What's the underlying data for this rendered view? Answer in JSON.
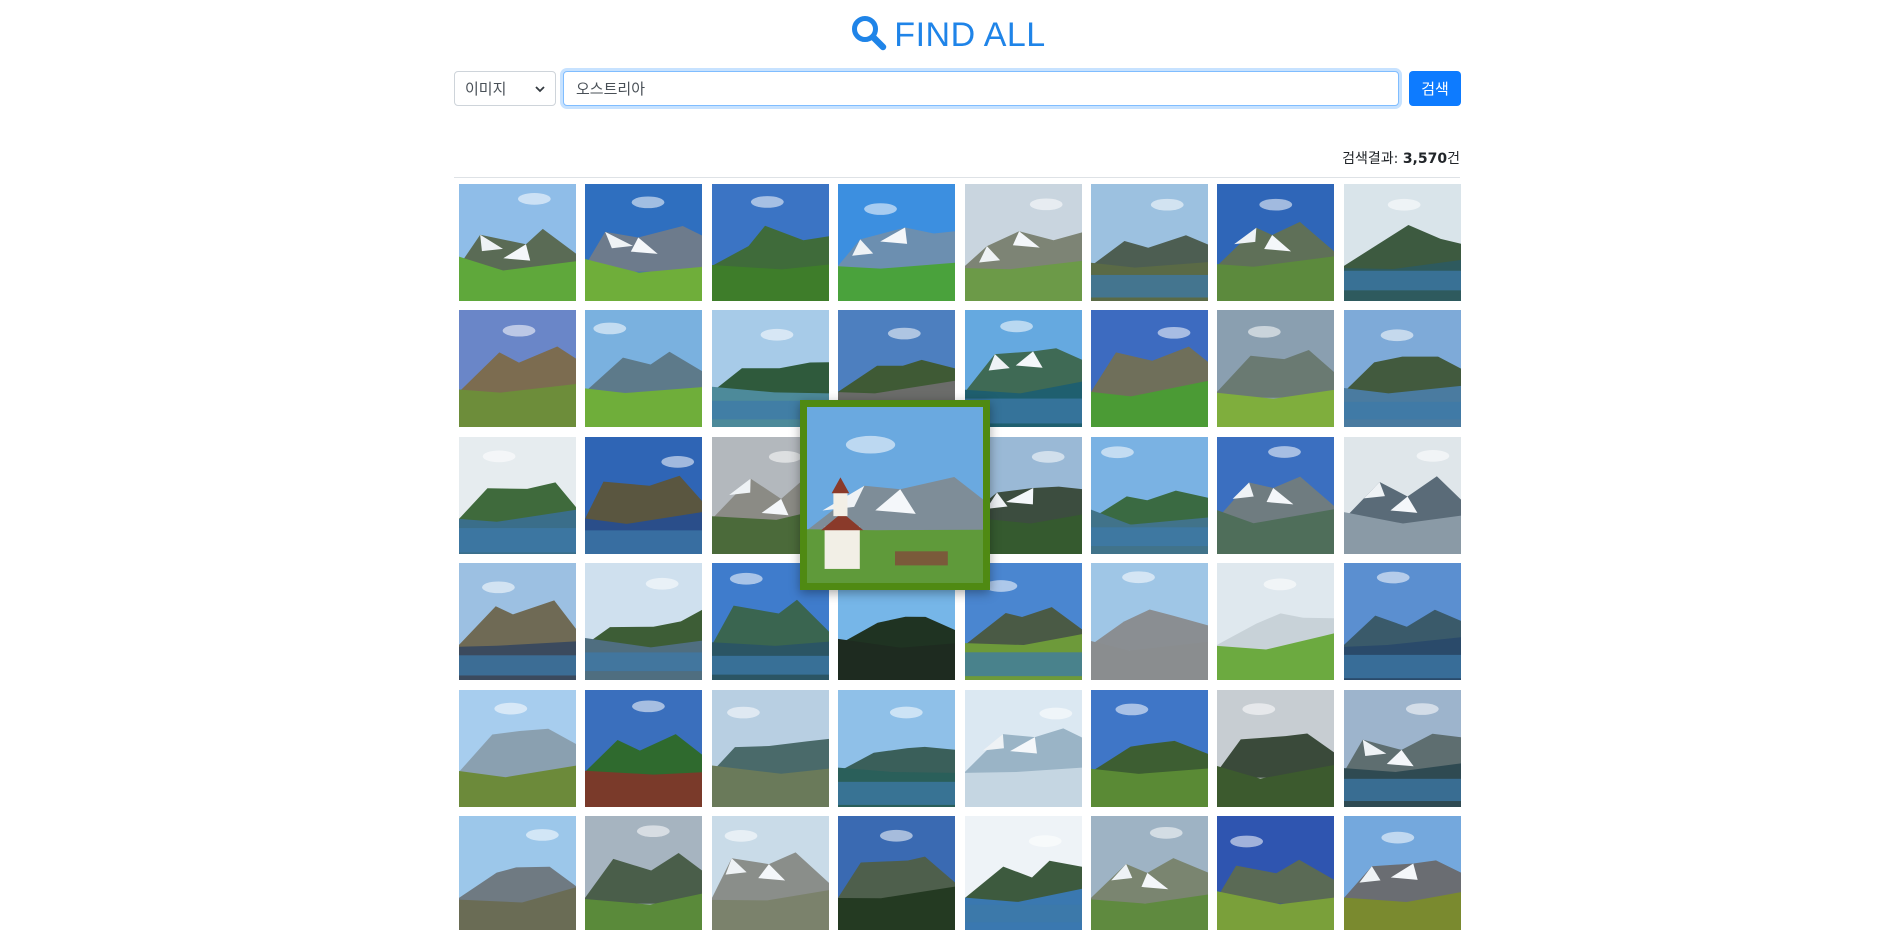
{
  "header": {
    "title": "FIND ALL",
    "icon": "search-icon",
    "color": "#1f84e8"
  },
  "search": {
    "type_selected": "이미지",
    "query": "오스트리아",
    "button_label": "검색",
    "button_color": "#0d7bff"
  },
  "results": {
    "summary_label": "검색결과:",
    "count": "3,570",
    "count_suffix": "건",
    "columns": 8,
    "rows": 6,
    "images": [
      {
        "sky": "#8fbde8",
        "mtn": "#5a6b55",
        "snow": true,
        "ground": "#5fa83b",
        "water": false
      },
      {
        "sky": "#2f6fbf",
        "mtn": "#6d7b8c",
        "snow": true,
        "ground": "#6fae3a",
        "water": false
      },
      {
        "sky": "#3b74c4",
        "mtn": "#3f6b3a",
        "snow": false,
        "ground": "#3e7d2a",
        "water": false
      },
      {
        "sky": "#3c8fe0",
        "mtn": "#6c8fb0",
        "snow": true,
        "ground": "#4aa23c",
        "water": false
      },
      {
        "sky": "#c9d5df",
        "mtn": "#7d8475",
        "snow": true,
        "ground": "#6c9a48",
        "water": false
      },
      {
        "sky": "#9cc1e0",
        "mtn": "#4d5e52",
        "snow": false,
        "ground": "#5a6a46",
        "water": true
      },
      {
        "sky": "#2f66b8",
        "mtn": "#5f7058",
        "snow": true,
        "ground": "#5c8a3d",
        "water": false
      },
      {
        "sky": "#d9e4ea",
        "mtn": "#3d5a40",
        "snow": false,
        "ground": "#2e5a5e",
        "water": true
      },
      {
        "sky": "#6a86c8",
        "mtn": "#7c6c50",
        "snow": false,
        "ground": "#6d8d3a",
        "water": false
      },
      {
        "sky": "#7ab1df",
        "mtn": "#5d7a8a",
        "snow": false,
        "ground": "#6fae3a",
        "water": false
      },
      {
        "sky": "#a7cbe8",
        "mtn": "#2f5a3c",
        "snow": false,
        "ground": "#4d8a9a",
        "water": true
      },
      {
        "sky": "#4d7fbf",
        "mtn": "#3f5a35",
        "snow": false,
        "ground": "#6b6c6a",
        "water": true
      },
      {
        "sky": "#65a9e0",
        "mtn": "#3f6a55",
        "snow": true,
        "ground": "#1f5f6f",
        "water": true
      },
      {
        "sky": "#3d6bc0",
        "mtn": "#6f6f5a",
        "snow": false,
        "ground": "#4b9b35",
        "water": false
      },
      {
        "sky": "#8a9fb0",
        "mtn": "#6a7a72",
        "snow": false,
        "ground": "#7fae3d",
        "water": false
      },
      {
        "sky": "#7eaad8",
        "mtn": "#425a3e",
        "snow": false,
        "ground": "#4a7ba0",
        "water": true
      },
      {
        "sky": "#e6ecef",
        "mtn": "#3f6a3c",
        "snow": false,
        "ground": "#3a6e8a",
        "water": true
      },
      {
        "sky": "#2f65b5",
        "mtn": "#5a5640",
        "snow": false,
        "ground": "#2a4e8a",
        "water": true
      },
      {
        "sky": "#b3b8bd",
        "mtn": "#8b8b85",
        "snow": true,
        "ground": "#4b6a3a",
        "water": false
      },
      {
        "sky": "#c5d8e8",
        "mtn": "#6a7e8e",
        "snow": true,
        "ground": "#5a7e4a",
        "water": false
      },
      {
        "sky": "#9ab9d6",
        "mtn": "#3c4d3f",
        "snow": true,
        "ground": "#355a2f",
        "water": false
      },
      {
        "sky": "#7ab2e3",
        "mtn": "#3a6a42",
        "snow": false,
        "ground": "#41738a",
        "water": true
      },
      {
        "sky": "#3b6fc0",
        "mtn": "#6f7c80",
        "snow": true,
        "ground": "#4f6e5a",
        "water": false
      },
      {
        "sky": "#dfe6ea",
        "mtn": "#5a6b78",
        "snow": true,
        "ground": "#8a9aa6",
        "water": false
      },
      {
        "sky": "#9cc0e2",
        "mtn": "#6f6a55",
        "snow": false,
        "ground": "#3b4a5e",
        "water": true
      },
      {
        "sky": "#cfe0ee",
        "mtn": "#3d5d36",
        "snow": false,
        "ground": "#4f6e80",
        "water": true
      },
      {
        "sky": "#3f7ccc",
        "mtn": "#3a6550",
        "snow": false,
        "ground": "#2b5564",
        "water": true
      },
      {
        "sky": "#76b6e8",
        "mtn": "#1f3322",
        "snow": false,
        "ground": "#1e2b20",
        "water": false
      },
      {
        "sky": "#4a86d0",
        "mtn": "#4a5a45",
        "snow": false,
        "ground": "#6d9a3a",
        "water": true
      },
      {
        "sky": "#9fc6e6",
        "mtn": "#8a8e92",
        "snow": false,
        "ground": "#8a8d8f",
        "water": false
      },
      {
        "sky": "#dfe8ee",
        "mtn": "#c8d2d8",
        "snow": false,
        "ground": "#6caa40",
        "water": false
      },
      {
        "sky": "#5b8fd0",
        "mtn": "#3a5a6a",
        "snow": false,
        "ground": "#2a4a6a",
        "water": true
      },
      {
        "sky": "#a7cdee",
        "mtn": "#8aa0b0",
        "snow": false,
        "ground": "#6c8a3a",
        "water": false
      },
      {
        "sky": "#3a6fbd",
        "mtn": "#2f6a2e",
        "snow": false,
        "ground": "#7a3a2a",
        "water": false
      },
      {
        "sky": "#b8cfe2",
        "mtn": "#4a6a6a",
        "snow": false,
        "ground": "#6a7a5a",
        "water": false
      },
      {
        "sky": "#8fc0e8",
        "mtn": "#3a5f5a",
        "snow": false,
        "ground": "#2a5f5a",
        "water": true
      },
      {
        "sky": "#dbe8f2",
        "mtn": "#9ab4c6",
        "snow": true,
        "ground": "#c5d6e2",
        "water": false
      },
      {
        "sky": "#3f76c7",
        "mtn": "#3d5e32",
        "snow": false,
        "ground": "#5a8a35",
        "water": false
      },
      {
        "sky": "#c7cdd2",
        "mtn": "#3a4a3a",
        "snow": false,
        "ground": "#3c5a2e",
        "water": false
      },
      {
        "sky": "#9db4cc",
        "mtn": "#5e6e70",
        "snow": true,
        "ground": "#2f4a52",
        "water": true
      },
      {
        "sky": "#9cc7ea",
        "mtn": "#6f7a82",
        "snow": false,
        "ground": "#6a6c55",
        "water": false
      },
      {
        "sky": "#a6b4c0",
        "mtn": "#4a5e4a",
        "snow": false,
        "ground": "#5a8a3a",
        "water": false
      },
      {
        "sky": "#c9dbe8",
        "mtn": "#8a8e8a",
        "snow": true,
        "ground": "#7b826c",
        "water": false
      },
      {
        "sky": "#3a6ab2",
        "mtn": "#4e5f4c",
        "snow": false,
        "ground": "#243a22",
        "water": false
      },
      {
        "sky": "#eef3f7",
        "mtn": "#3d5a3e",
        "snow": false,
        "ground": "#3a78b0",
        "water": true
      },
      {
        "sky": "#9eb3c4",
        "mtn": "#7a8570",
        "snow": true,
        "ground": "#5f8a3f",
        "water": false
      },
      {
        "sky": "#2f55b0",
        "mtn": "#5a6a55",
        "snow": false,
        "ground": "#7aa03a",
        "water": false
      },
      {
        "sky": "#74a8dd",
        "mtn": "#6a6d72",
        "snow": true,
        "ground": "#7a8a2f",
        "water": false
      }
    ]
  },
  "preview": {
    "sky": "#6aa9e0",
    "mtn": "#7e8d98",
    "ground": "#5f9a3a",
    "border_color": "#4f8a12"
  }
}
